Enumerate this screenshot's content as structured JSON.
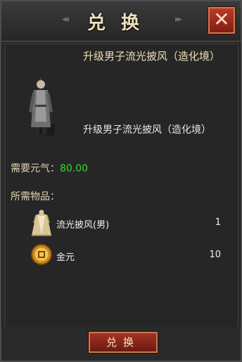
{
  "header": {
    "title": "兑换",
    "close_symbol": "✕",
    "deco_left": "◂◂",
    "deco_right": "▸▸"
  },
  "item": {
    "title": "升级男子流光披风（造化境）",
    "subtitle": "升级男子流光披风（造化境）",
    "figure_icon": "male-character-figure-icon"
  },
  "cost": {
    "label": "需要元气：",
    "value": "80.00",
    "value_color": "#3bd62f"
  },
  "requirements": {
    "label": "所需物品：",
    "items": [
      {
        "name": "流光披风(男)",
        "qty": "1",
        "icon": "cloak-icon"
      },
      {
        "name": "金元",
        "qty": "10",
        "icon": "gold-coin-icon"
      }
    ]
  },
  "footer": {
    "exchange_label": "兑换"
  },
  "colors": {
    "title": "#f0dfb8",
    "panel": "#2c2c2c",
    "close_button": "#a6321f",
    "exchange_button": "#8a2416"
  }
}
